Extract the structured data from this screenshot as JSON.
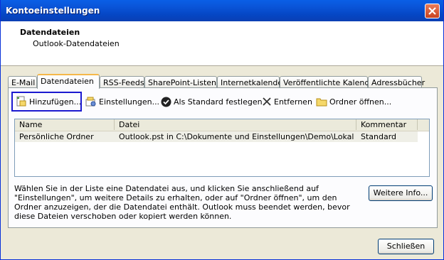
{
  "window": {
    "title": "Kontoeinstellungen"
  },
  "header": {
    "title": "Datendateien",
    "subtitle": "Outlook-Datendateien"
  },
  "tabs": [
    {
      "label": "E-Mail"
    },
    {
      "label": "Datendateien"
    },
    {
      "label": "RSS-Feeds"
    },
    {
      "label": "SharePoint-Listen"
    },
    {
      "label": "Internetkalender"
    },
    {
      "label": "Veröffentlichte Kalender"
    },
    {
      "label": "Adressbücher"
    }
  ],
  "toolbar": {
    "add": "Hinzufügen...",
    "settings": "Einstellungen...",
    "set_default": "Als Standard festlegen",
    "remove": "Entfernen",
    "open_folder": "Ordner öffnen..."
  },
  "list": {
    "columns": [
      "Name",
      "Datei",
      "Kommentar"
    ],
    "rows": [
      {
        "name": "Persönliche Ordner",
        "file": "Outlook.pst in C:\\Dokumente und Einstellungen\\Demo\\Lokale Eins...",
        "comment": "Standard"
      }
    ]
  },
  "description": "Wählen Sie in der Liste eine Datendatei aus, und klicken Sie anschließend auf \"Einstellungen\", um weitere Details zu erhalten, oder auf \"Ordner öffnen\", um den Ordner anzuzeigen, der die Datendatei enthält. Outlook muss beendet werden, bevor diese Dateien verschoben oder kopiert werden können.",
  "buttons": {
    "more_info": "Weitere Info...",
    "close": "Schließen"
  }
}
